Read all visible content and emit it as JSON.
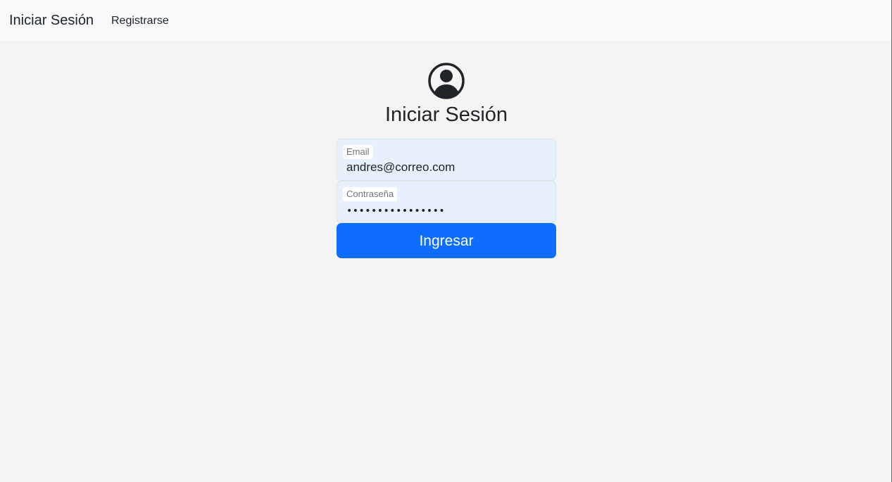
{
  "navbar": {
    "brand": "Iniciar Sesión",
    "links": [
      {
        "label": "Registrarse"
      }
    ]
  },
  "login": {
    "icon": "user-circle-icon",
    "title": "Iniciar Sesión",
    "email": {
      "label": "Email",
      "value": "andres@correo.com"
    },
    "password": {
      "label": "Contraseña",
      "masked_value": "••••••••••••••••"
    },
    "submit_label": "Ingresar"
  },
  "colors": {
    "primary": "#0d6efd",
    "navbar_bg": "#f8f9fa",
    "page_bg": "#f4f4f4",
    "autofill_bg": "#e8f0fe",
    "text": "#212529"
  }
}
